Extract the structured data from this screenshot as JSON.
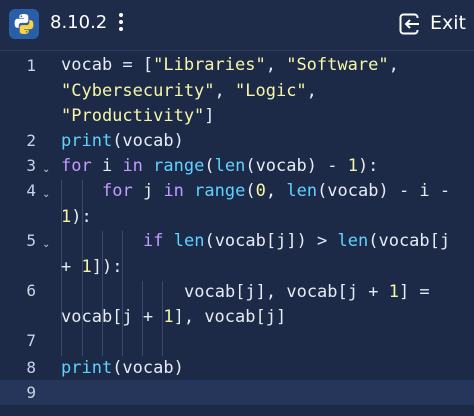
{
  "header": {
    "version": "8.10.2",
    "exit_label": "Exit"
  },
  "editor": {
    "line_numbers": [
      "1",
      "2",
      "3",
      "4",
      "5",
      "6",
      "7",
      "8",
      "9"
    ],
    "lines": [
      {
        "parts": [
          [
            "plain",
            "vocab = ["
          ],
          [
            "str",
            "\"Libraries\""
          ],
          [
            "plain",
            ", "
          ],
          [
            "str",
            "\"Software\""
          ],
          [
            "plain",
            ","
          ]
        ]
      },
      {
        "parts": [
          [
            "str",
            "\"Cybersecurity\""
          ],
          [
            "plain",
            ", "
          ],
          [
            "str",
            "\"Logic\""
          ],
          [
            "plain",
            ","
          ]
        ]
      },
      {
        "parts": [
          [
            "str",
            "\"Productivity\""
          ],
          [
            "plain",
            "]"
          ]
        ]
      },
      {
        "parts": [
          [
            "fn",
            "print"
          ],
          [
            "plain",
            "(vocab)"
          ]
        ]
      },
      {
        "parts": [
          [
            "kw",
            "for"
          ],
          [
            "plain",
            " i "
          ],
          [
            "kw",
            "in"
          ],
          [
            "plain",
            " "
          ],
          [
            "fn",
            "range"
          ],
          [
            "plain",
            "("
          ],
          [
            "fn",
            "len"
          ],
          [
            "plain",
            "(vocab) - "
          ],
          [
            "num",
            "1"
          ],
          [
            "plain",
            "):"
          ]
        ]
      },
      {
        "parts": [
          [
            "kw",
            "for"
          ],
          [
            "plain",
            " j "
          ],
          [
            "kw",
            "in"
          ],
          [
            "plain",
            " "
          ],
          [
            "fn",
            "range"
          ],
          [
            "plain",
            "("
          ],
          [
            "num",
            "0"
          ],
          [
            "plain",
            ", "
          ],
          [
            "fn",
            "len"
          ],
          [
            "plain",
            "(vocab) - i -"
          ]
        ]
      },
      {
        "parts": [
          [
            "num",
            "1"
          ],
          [
            "plain",
            "):"
          ]
        ]
      },
      {
        "parts": [
          [
            "kw",
            "if"
          ],
          [
            "plain",
            " "
          ],
          [
            "fn",
            "len"
          ],
          [
            "plain",
            "(vocab[j]) > "
          ],
          [
            "fn",
            "len"
          ],
          [
            "plain",
            "(vocab[j"
          ]
        ]
      },
      {
        "parts": [
          [
            "plain",
            "+ "
          ],
          [
            "num",
            "1"
          ],
          [
            "plain",
            "]):"
          ]
        ]
      },
      {
        "parts": [
          [
            "plain",
            "vocab[j], vocab[j + "
          ],
          [
            "num",
            "1"
          ],
          [
            "plain",
            "] ="
          ]
        ]
      },
      {
        "parts": [
          [
            "plain",
            "vocab[j + "
          ],
          [
            "num",
            "1"
          ],
          [
            "plain",
            "], vocab[j]"
          ]
        ]
      },
      {
        "parts": [
          [
            "fn",
            "print"
          ],
          [
            "plain",
            "(vocab)"
          ]
        ]
      }
    ]
  }
}
